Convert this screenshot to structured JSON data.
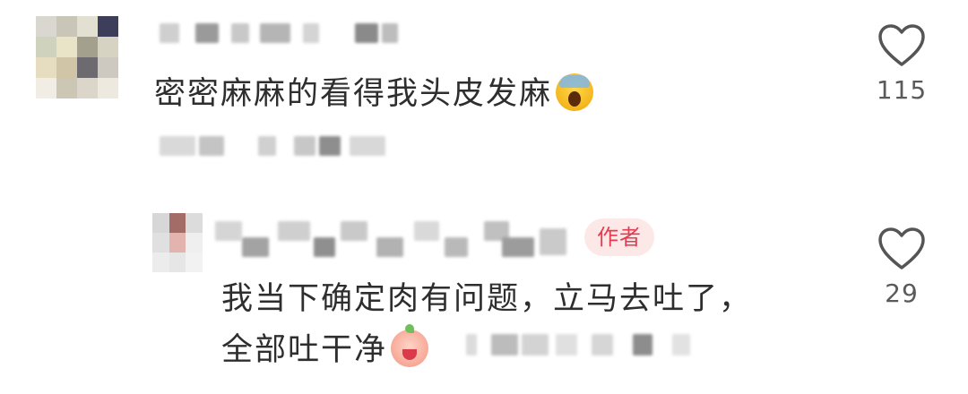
{
  "comments": [
    {
      "text": "密密麻麻的看得我头皮发麻",
      "emoji": "screaming-face-emoji",
      "likes": "115"
    },
    {
      "author_badge": "作者",
      "text_line1": "我当下确定肉有问题，立马去吐了，",
      "text_line2": "全部吐干净",
      "emoji": "angry-peach-emoji",
      "likes": "29"
    }
  ],
  "icons": {
    "like": "heart-outline-icon"
  },
  "colors": {
    "badge_bg": "#fde8e8",
    "badge_text": "#e33b4f",
    "text": "#2e2e2e",
    "count": "#5a5a5a"
  }
}
